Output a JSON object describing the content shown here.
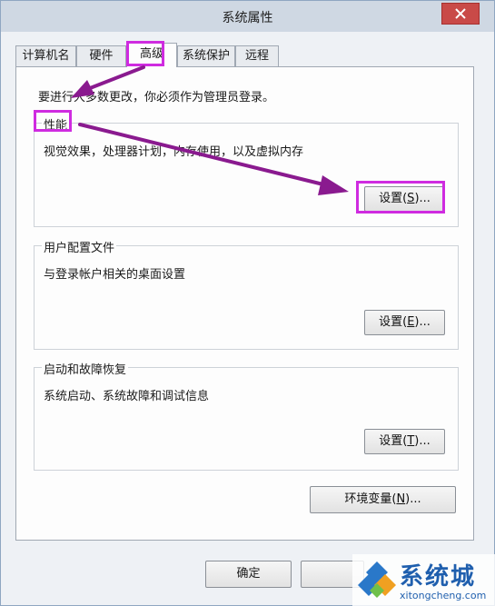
{
  "window": {
    "title": "系统属性"
  },
  "tabs": [
    {
      "label": "计算机名"
    },
    {
      "label": "硬件"
    },
    {
      "label": "高级",
      "active": true
    },
    {
      "label": "系统保护"
    },
    {
      "label": "远程"
    }
  ],
  "advanced": {
    "admin_note": "要进行大多数更改，你必须作为管理员登录。",
    "performance": {
      "title": "性能",
      "description": "视觉效果，处理器计划，内存使用，以及虚拟内存",
      "button_text": "设置(",
      "button_key": "S",
      "button_tail": ")..."
    },
    "user_profiles": {
      "title": "用户配置文件",
      "description": "与登录帐户相关的桌面设置",
      "button_text": "设置(",
      "button_key": "E",
      "button_tail": ")..."
    },
    "startup_recovery": {
      "title": "启动和故障恢复",
      "description": "系统启动、系统故障和调试信息",
      "button_text": "设置(",
      "button_key": "T",
      "button_tail": ")..."
    },
    "env_vars": {
      "button_text": "环境变量(",
      "button_key": "N",
      "button_tail": ")..."
    }
  },
  "footer": {
    "ok_label": "确定"
  },
  "annotation": {
    "highlight_color": "#cf2be0",
    "arrow_color": "#8a1a8f"
  },
  "watermark": {
    "name": "系统城",
    "domain": "xitongcheng.com"
  },
  "colors": {
    "close_button": "#c94a48",
    "brand_blue": "#1f5fae"
  }
}
